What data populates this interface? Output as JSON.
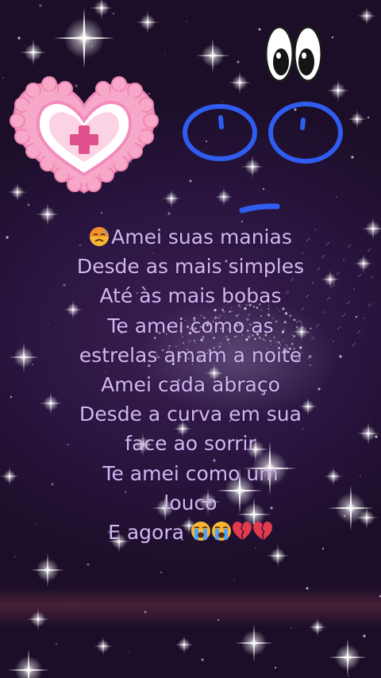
{
  "decorations": {
    "heart_sticker": "nurse-heart-sticker",
    "eyes_sticker": "cartoon-eyes-sticker",
    "doodle_face": "blue-drawn-eyes-and-mouth",
    "background": "starry-purple-night-sky"
  },
  "poem": {
    "lead_emoji": "sad-sweat-face-emoji",
    "lines": [
      "Amei suas manias",
      "Desde as mais simples",
      "Até às mais bobas",
      "Te amei como as",
      "estrelas amam a noite",
      "Amei cada abraço",
      "Desde a curva em sua",
      "face ao sorrir",
      "Te amei como um",
      "louco",
      "E agora"
    ],
    "trailing_emojis": [
      "crying-face-emoji",
      "crying-face-emoji",
      "broken-heart-emoji",
      "broken-heart-emoji"
    ]
  },
  "colors": {
    "background": "#2a1540",
    "text": "#cfb8f0",
    "heart_pink": "#f6a3c8",
    "doodle_blue": "#2f5df0"
  }
}
